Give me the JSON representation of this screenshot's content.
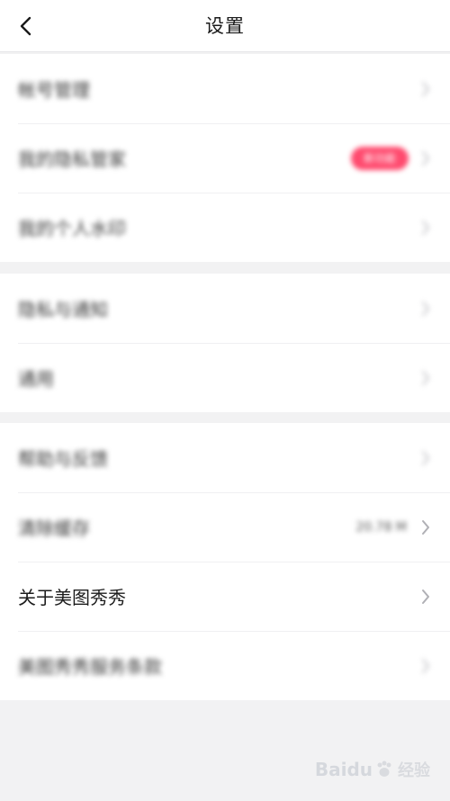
{
  "header": {
    "title": "设置",
    "back_icon": "chevron-left-icon"
  },
  "groups": [
    {
      "items": [
        {
          "label": "帐号管理",
          "blurred": true
        },
        {
          "label": "我的隐私管家",
          "blurred": true,
          "badge": "新功能"
        },
        {
          "label": "我的个人水印",
          "blurred": true
        }
      ]
    },
    {
      "items": [
        {
          "label": "隐私与通知",
          "blurred": true
        },
        {
          "label": "通用",
          "blurred": true
        }
      ]
    },
    {
      "items": [
        {
          "label": "帮助与反馈",
          "blurred": true
        },
        {
          "label": "清除缓存",
          "blurred": true,
          "value": "20.78 M"
        },
        {
          "label": "关于美图秀秀",
          "blurred": false
        },
        {
          "label": "美图秀秀服务条款",
          "blurred": true
        }
      ]
    }
  ],
  "watermark": {
    "brand": "Baidu",
    "sub": "经验"
  },
  "colors": {
    "badge": "#ff4a6e",
    "background": "#f2f2f3",
    "chevron": "#c2c2c6"
  }
}
